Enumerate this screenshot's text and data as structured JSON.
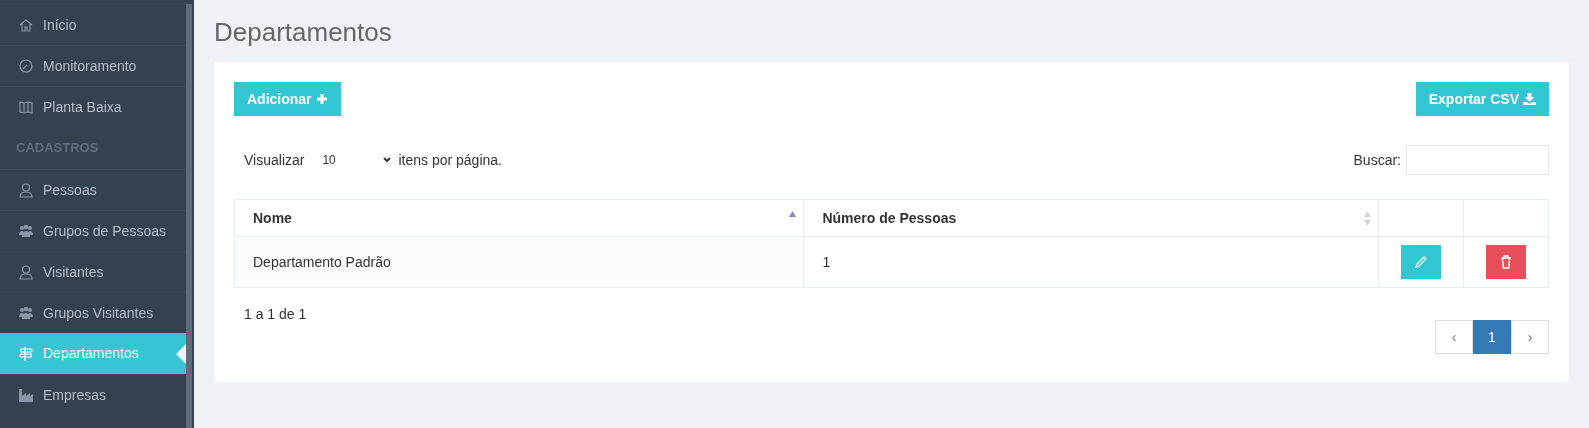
{
  "sidebar": {
    "items": [
      {
        "kind": "item",
        "label": "Início",
        "selected": false
      },
      {
        "kind": "item",
        "label": "Monitoramento",
        "selected": false
      },
      {
        "kind": "item",
        "label": "Planta Baixa",
        "selected": false
      },
      {
        "kind": "header",
        "label": "CADASTROS"
      },
      {
        "kind": "item",
        "label": "Pessoas",
        "selected": false
      },
      {
        "kind": "item",
        "label": "Grupos de Pessoas",
        "selected": false
      },
      {
        "kind": "item",
        "label": "Visitantes",
        "selected": false
      },
      {
        "kind": "item",
        "label": "Grupos Visitantes",
        "selected": false
      },
      {
        "kind": "item",
        "label": "Departamentos",
        "selected": true
      },
      {
        "kind": "item",
        "label": "Empresas",
        "selected": false
      }
    ]
  },
  "page_title": "Departamentos",
  "toolbar": {
    "add_button": "Adicionar",
    "export_button": "Exportar CSV"
  },
  "page_size": {
    "label_before": "Visualizar",
    "value": "10",
    "label_after": "itens por página."
  },
  "search": {
    "label": "Buscar:"
  },
  "table": {
    "columns": [
      {
        "label": "Nome",
        "sorted": true
      },
      {
        "label": "Número de Pessoas",
        "sorted": false
      }
    ],
    "rows": [
      {
        "cells": [
          "Departamento Padrão",
          "1"
        ]
      }
    ]
  },
  "info": "1 a 1 de 1",
  "pagination": {
    "prev": "‹",
    "pages": [
      {
        "label": "1",
        "selected": true
      }
    ],
    "next": "›"
  }
}
